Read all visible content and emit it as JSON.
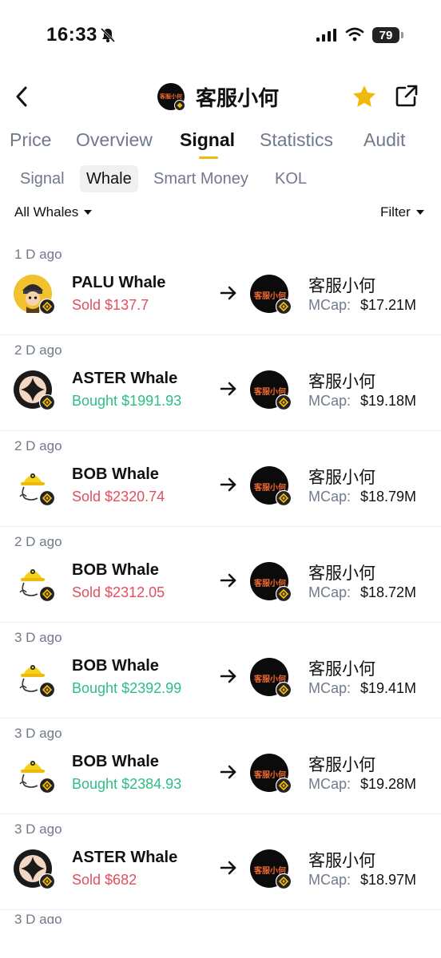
{
  "status": {
    "time": "16:33",
    "battery": "79"
  },
  "header": {
    "title": "客服小何",
    "token_logo_text": "客服小何"
  },
  "tabs": [
    {
      "label": "Price"
    },
    {
      "label": "Overview"
    },
    {
      "label": "Signal",
      "active": true
    },
    {
      "label": "Statistics"
    },
    {
      "label": "Audit"
    }
  ],
  "subtabs": [
    {
      "label": "Signal"
    },
    {
      "label": "Whale",
      "active": true
    },
    {
      "label": "Smart Money"
    },
    {
      "label": "KOL"
    }
  ],
  "filters": {
    "left": "All Whales",
    "right": "Filter"
  },
  "mcap_label": "MCap:",
  "rows": [
    {
      "time": "1 D ago",
      "whale": "PALU Whale",
      "action": "Sold",
      "amount": "$137.7",
      "type": "sold",
      "avatar": "palu",
      "target": "客服小何",
      "mcap": "$17.21M"
    },
    {
      "time": "2 D ago",
      "whale": "ASTER Whale",
      "action": "Bought",
      "amount": "$1991.93",
      "type": "bought",
      "avatar": "aster",
      "target": "客服小何",
      "mcap": "$19.18M"
    },
    {
      "time": "2 D ago",
      "whale": "BOB Whale",
      "action": "Sold",
      "amount": "$2320.74",
      "type": "sold",
      "avatar": "bob",
      "target": "客服小何",
      "mcap": "$18.79M"
    },
    {
      "time": "2 D ago",
      "whale": "BOB Whale",
      "action": "Sold",
      "amount": "$2312.05",
      "type": "sold",
      "avatar": "bob",
      "target": "客服小何",
      "mcap": "$18.72M"
    },
    {
      "time": "3 D ago",
      "whale": "BOB Whale",
      "action": "Bought",
      "amount": "$2392.99",
      "type": "bought",
      "avatar": "bob",
      "target": "客服小何",
      "mcap": "$19.41M"
    },
    {
      "time": "3 D ago",
      "whale": "BOB Whale",
      "action": "Bought",
      "amount": "$2384.93",
      "type": "bought",
      "avatar": "bob",
      "target": "客服小何",
      "mcap": "$19.28M"
    },
    {
      "time": "3 D ago",
      "whale": "ASTER Whale",
      "action": "Sold",
      "amount": "$682",
      "type": "sold",
      "avatar": "aster",
      "target": "客服小何",
      "mcap": "$18.97M"
    }
  ],
  "partial_row_time": "3 D ago",
  "colors": {
    "sold": "#e04f5f",
    "bought": "#2ebd85",
    "accent": "#f0b90b"
  },
  "icons": [
    "bell-off-icon",
    "signal-bars-icon",
    "wifi-icon",
    "battery-icon",
    "back-arrow-icon",
    "star-icon",
    "share-icon",
    "arrow-right-icon",
    "bnb-chain-badge-icon"
  ]
}
